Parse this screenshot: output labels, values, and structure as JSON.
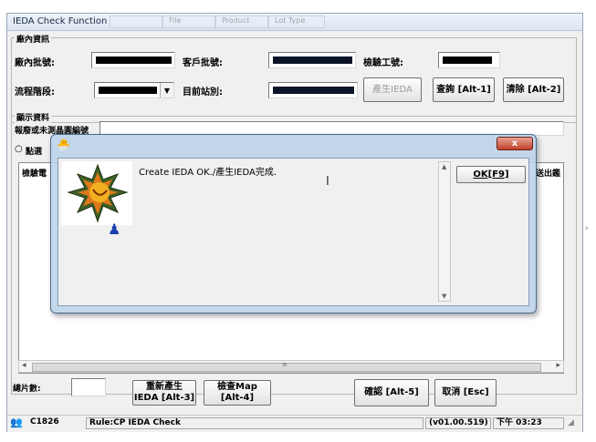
{
  "window": {
    "title": "IEDA Check Function",
    "ghost_tabs": [
      "",
      "File",
      "Product",
      "Lot Type"
    ]
  },
  "factory_info": {
    "group_label": "廠內資訊",
    "lot_label": "廠內批號:",
    "customer_lot_label": "客戶批號:",
    "test_no_label": "檢驗工號:",
    "process_stage_label": "流程階段:",
    "station_label": "目前站別:",
    "generate_button": "產生IEDA",
    "query_button": "查詢 [Alt-1]",
    "clear_button": "清除 [Alt-2]"
  },
  "display_info": {
    "group_label": "顯示資料",
    "report_label": "報廢或未測晶圓編號",
    "radio_label": "點選",
    "left_col_header": "檢驗電",
    "right_col_header": "送出鑑"
  },
  "bottom": {
    "wafer_count_label": "總片數:",
    "regen_button_line1": "重新產生",
    "regen_button_line2": "IEDA [Alt-3]",
    "check_map_line1": "檢查Map",
    "check_map_line2": "[Alt-4]",
    "confirm_button": "確認 [Alt-5]",
    "cancel_button": "取消 [Esc]"
  },
  "statusbar": {
    "user": "C1826",
    "rule": "Rule:CP IEDA Check",
    "version": "(v01.00.519)",
    "time": "下午 03:23"
  },
  "dialog": {
    "message": "Create IEDA OK./產生IEDA完成.",
    "ok_button": "OK[F9]",
    "close_glyph": "x"
  },
  "colors": {
    "accent_blue": "#2b5b9a",
    "dialog_frame": "#bad1e8",
    "close_red": "#c2402a"
  }
}
